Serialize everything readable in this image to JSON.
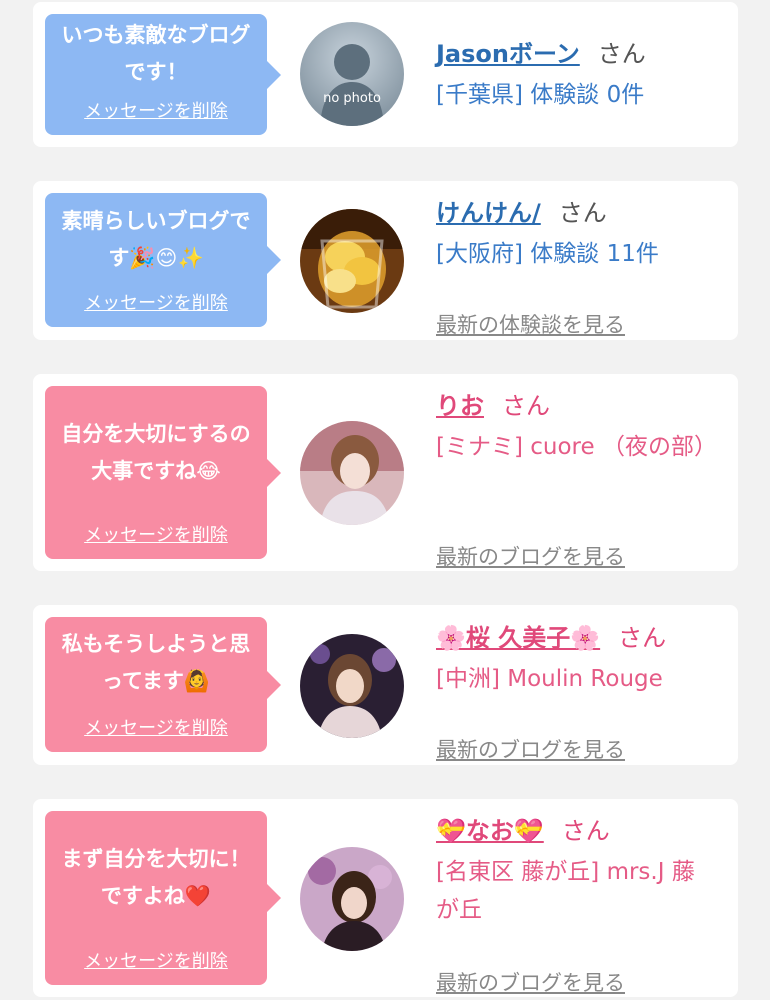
{
  "cards": [
    {
      "theme": "blue",
      "message": "いつも素敵なブログです！",
      "delete_label": "メッセージを削除",
      "avatar": "no-photo",
      "avatar_text": "no photo",
      "name": "Jasonボーン",
      "san": "さん",
      "location": "[千葉県] 体験談 0件",
      "more_label": ""
    },
    {
      "theme": "blue",
      "message": "素晴らしいブログです🎉😊✨",
      "delete_label": "メッセージを削除",
      "avatar": "lemon-drink-photo",
      "name": "けんけん/",
      "san": "さん",
      "location": "[大阪府] 体験談 11件",
      "more_label": "最新の体験談を見る"
    },
    {
      "theme": "pink",
      "message": "自分を大切にするの大事ですね😂",
      "delete_label": "メッセージを削除",
      "avatar": "woman-photo",
      "name": "りお",
      "san": "さん",
      "location": "[ミナミ] cuore （夜の部）",
      "more_label": "最新のブログを見る"
    },
    {
      "theme": "pink",
      "message": "私もそうしようと思ってます🙆",
      "delete_label": "メッセージを削除",
      "avatar": "woman-photo",
      "name": "🌸桜 久美子🌸",
      "san": "さん",
      "location": "[中洲] Moulin Rouge",
      "more_label": "最新のブログを見る"
    },
    {
      "theme": "pink",
      "message": "まず自分を大切に！ですよね❤️",
      "delete_label": "メッセージを削除",
      "avatar": "woman-photo",
      "name": "💝なお💝",
      "san": "さん",
      "location": "[名東区 藤が丘] mrs.J 藤が丘",
      "more_label": "最新のブログを見る"
    }
  ]
}
